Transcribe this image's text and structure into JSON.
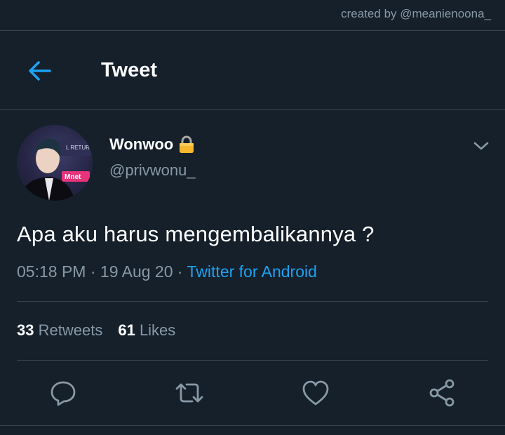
{
  "watermark": "created by @meanienoona_",
  "header": {
    "title": "Tweet",
    "back_icon": "arrow-left-icon",
    "accent_color": "#1da1f2"
  },
  "author": {
    "display_name": "Wonwoo",
    "handle": "@privwonu_",
    "lock_icon": "lock-icon",
    "avatar_badge": "Mnet",
    "avatar_caption": "L RETURN"
  },
  "tweet": {
    "text": "Apa aku harus mengembalikannya ?",
    "time": "05:18 PM",
    "date": "19 Aug 20",
    "separator": " · ",
    "source": "Twitter for Android"
  },
  "stats": {
    "retweets_count": "33",
    "retweets_label": "Retweets",
    "likes_count": "61",
    "likes_label": "Likes"
  },
  "actions": [
    "reply-icon",
    "retweet-icon",
    "like-icon",
    "share-icon"
  ],
  "colors": {
    "background": "#15202b",
    "muted_text": "#8899a6",
    "divider": "#38444d",
    "link": "#1da1f2"
  }
}
